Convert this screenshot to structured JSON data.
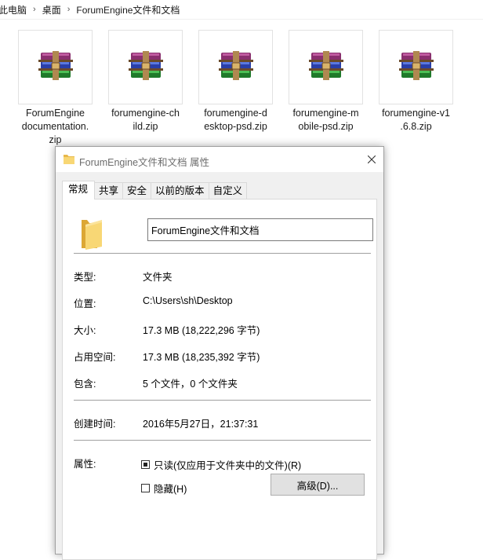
{
  "breadcrumb": {
    "items": [
      "此电脑",
      "桌面",
      "ForumEngine文件和文档"
    ]
  },
  "files": [
    {
      "name": "ForumEngine documentation.zip",
      "lines": [
        "ForumEngine",
        "documentation.",
        "zip"
      ],
      "icon": "winrar-archive-icon"
    },
    {
      "name": "forumengine-child.zip",
      "lines": [
        "forumengine-ch",
        "ild.zip"
      ],
      "icon": "winrar-archive-icon"
    },
    {
      "name": "forumengine-desktop-psd.zip",
      "lines": [
        "forumengine-d",
        "esktop-psd.zip"
      ],
      "icon": "winrar-archive-icon"
    },
    {
      "name": "forumengine-mobile-psd.zip",
      "lines": [
        "forumengine-m",
        "obile-psd.zip"
      ],
      "icon": "winrar-archive-icon"
    },
    {
      "name": "forumengine-v1.6.8.zip",
      "lines": [
        "forumengine-v1",
        ".6.8.zip"
      ],
      "icon": "winrar-archive-icon"
    }
  ],
  "dialog": {
    "title": "ForumEngine文件和文档 属性",
    "tabs": [
      "常规",
      "共享",
      "安全",
      "以前的版本",
      "自定义"
    ],
    "active_tab": "常规",
    "folder_name": "ForumEngine文件和文档",
    "properties": {
      "type_label": "类型:",
      "type_value": "文件夹",
      "location_label": "位置:",
      "location_value": "C:\\Users\\sh\\Desktop",
      "size_label": "大小:",
      "size_value": "17.3 MB (18,222,296 字节)",
      "disk_size_label": "占用空间:",
      "disk_size_value": "17.3 MB (18,235,392 字节)",
      "contains_label": "包含:",
      "contains_value": "5 个文件，0 个文件夹",
      "created_label": "创建时间:",
      "created_value": "2016年5月27日，21:37:31",
      "attributes_label": "属性:"
    },
    "attributes": {
      "readonly_label": "只读(仅应用于文件夹中的文件)(R)",
      "readonly_state": "indeterminate",
      "hidden_label": "隐藏(H)",
      "hidden_checked": false,
      "advanced_button": "高级(D)..."
    }
  },
  "colors": {
    "folder_yellow": "#f8d775",
    "dialog_bg": "#f0f0f0",
    "panel_bg": "#ffffff"
  }
}
